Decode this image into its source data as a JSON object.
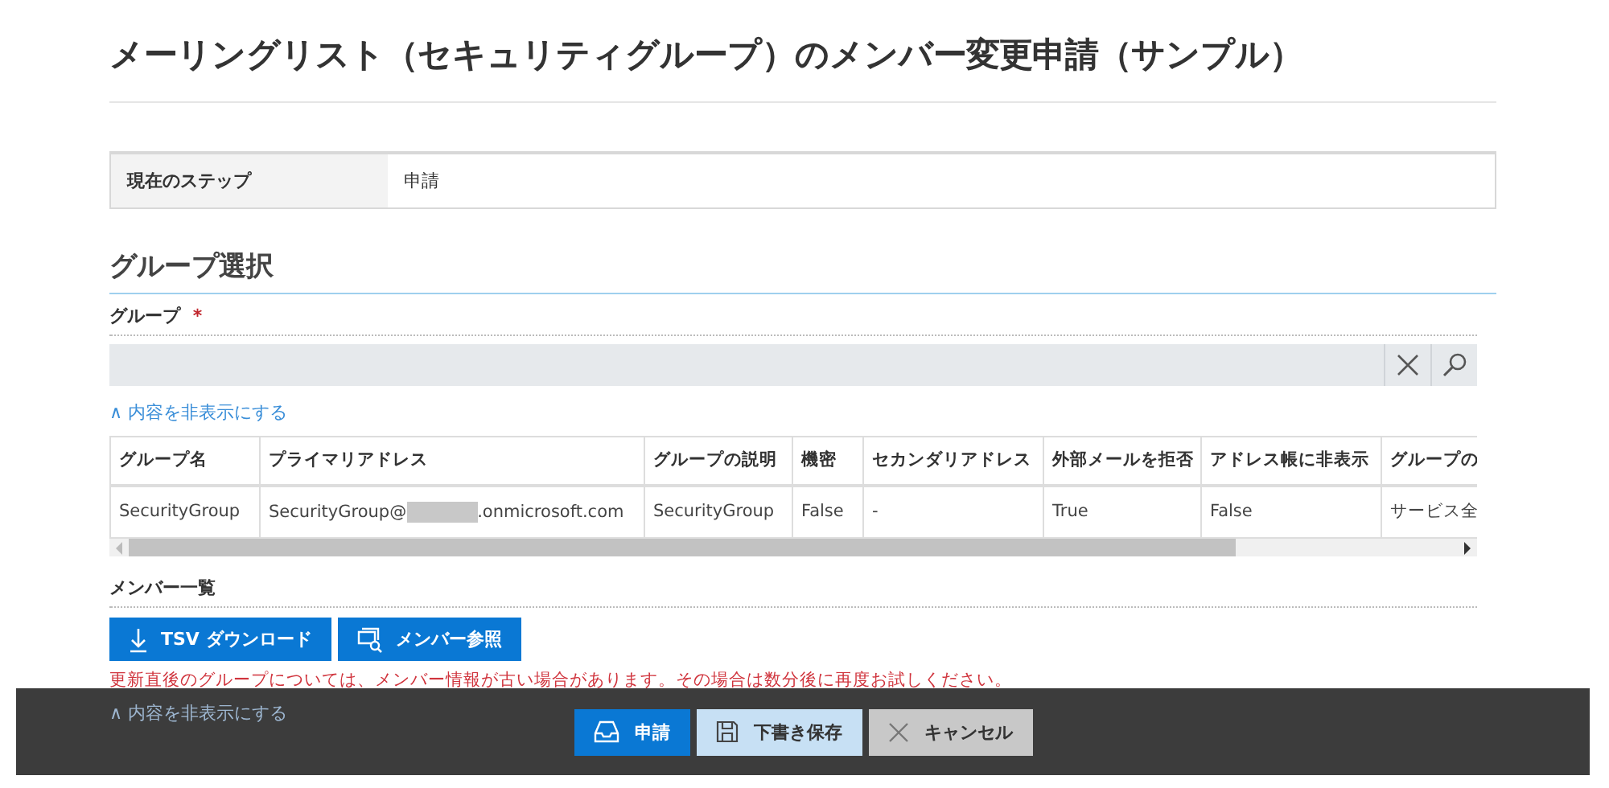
{
  "page": {
    "title": "メーリングリスト（セキュリティグループ）のメンバー変更申請（サンプル）"
  },
  "step": {
    "label": "現在のステップ",
    "value": "申請"
  },
  "section": {
    "title": "グループ選択"
  },
  "group_field": {
    "label": "グループ",
    "required_mark": "*",
    "collapse_link": "∧ 内容を非表示にする"
  },
  "table": {
    "columns": [
      "グループ名",
      "プライマリアドレス",
      "グループの説明",
      "機密",
      "セカンダリアドレス",
      "外部メールを拒否",
      "アドレス帳に非表示",
      "グループの"
    ],
    "rows": [
      [
        {
          "text": "SecurityGroup"
        },
        {
          "parts": [
            "SecurityGroup@",
            ".onmicrosoft.com"
          ],
          "redacted": true
        },
        {
          "text": "SecurityGroup"
        },
        {
          "text": "False"
        },
        {
          "text": "-"
        },
        {
          "text": "True"
        },
        {
          "text": "False"
        },
        {
          "text": "サービス全"
        }
      ]
    ]
  },
  "members": {
    "label": "メンバー一覧",
    "buttons": [
      {
        "kind": "download",
        "label": "TSV ダウンロード"
      },
      {
        "kind": "lookup",
        "label": "メンバー参照"
      }
    ],
    "warning": "更新直後のグループについては、メンバー情報が古い場合があります。その場合は数分後に再度お試しください。",
    "collapse_link": "∧ 内容を非表示にする"
  },
  "footer": {
    "buttons": [
      {
        "kind": "submit",
        "label": "申請"
      },
      {
        "kind": "draft",
        "label": "下書き保存"
      },
      {
        "kind": "cancel",
        "label": "キャンセル"
      }
    ]
  }
}
